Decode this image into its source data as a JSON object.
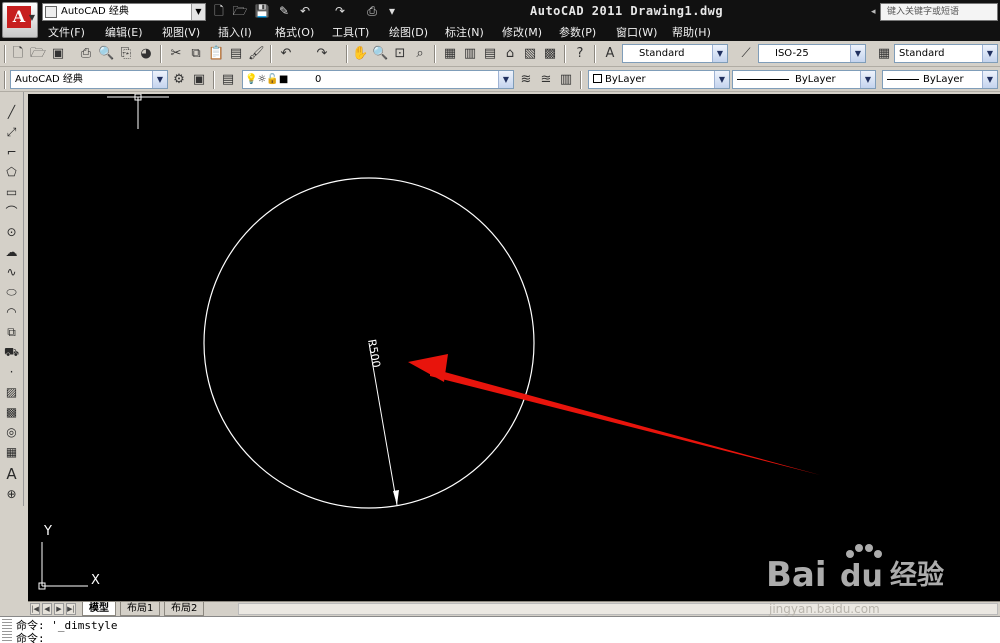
{
  "title_bar": {
    "title": "AutoCAD 2011    Drawing1.dwg",
    "workspace_top": "AutoCAD 经典",
    "search_placeholder": "键入关键字或短语",
    "app_logo": "A"
  },
  "menu": {
    "items": [
      "文件(F)",
      "编辑(E)",
      "视图(V)",
      "插入(I)",
      "格式(O)",
      "工具(T)",
      "绘图(D)",
      "标注(N)",
      "修改(M)",
      "参数(P)",
      "窗口(W)",
      "帮助(H)"
    ]
  },
  "styles_toolbar": {
    "text_style": "Standard",
    "dim_style": "ISO-25",
    "table_style": "Standard"
  },
  "layers_toolbar": {
    "workspace": "AutoCAD 经典",
    "layer": "0",
    "color": "ByLayer",
    "linetype": "ByLayer",
    "lineweight": "ByLayer"
  },
  "drawing": {
    "dimension_text": "R500",
    "ucs_x": "X",
    "ucs_y": "Y"
  },
  "tabs": [
    "模型",
    "布局1",
    "布局2"
  ],
  "command_line": {
    "line1": "命令: '_dimstyle",
    "line2": "命令:"
  },
  "watermark": {
    "brand": "Bai",
    "brand2": "du",
    "suffix": "经验",
    "url": "jingyan.baidu.com"
  },
  "colors": {
    "canvas": "#000000",
    "geometry": "#ffffff",
    "annotation_arrow": "#e8140c",
    "title_bar": "#111111",
    "toolbar": "#d4d0c8"
  }
}
